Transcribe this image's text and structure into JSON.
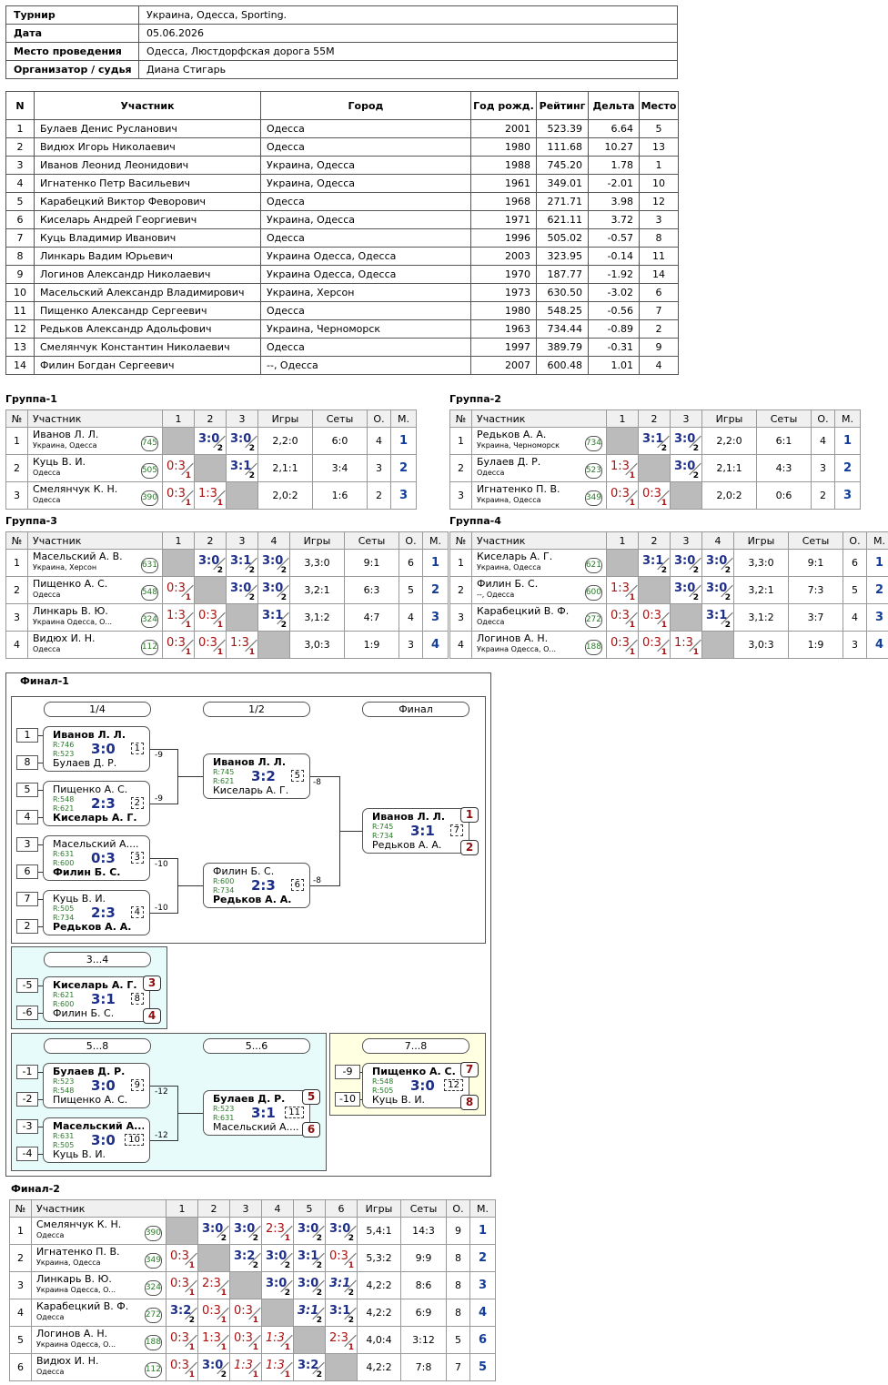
{
  "info": {
    "rows": [
      {
        "k": "Турнир",
        "v": "Украина, Одесса, Sporting."
      },
      {
        "k": "Дата",
        "v": "05.06.2026"
      },
      {
        "k": "Место проведения",
        "v": "Одесса, Люстдорфская дорога 55М"
      },
      {
        "k": "Организатор / судья",
        "v": "Диана Стигарь"
      }
    ]
  },
  "players_table": {
    "headers": [
      "N",
      "Участник",
      "Город",
      "Год рожд.",
      "Рейтинг",
      "Дельта",
      "Место"
    ],
    "rows": [
      [
        "1",
        "Булаев Денис Русланович",
        "Одесса",
        "2001",
        "523.39",
        "6.64",
        "5"
      ],
      [
        "2",
        "Видюх Игорь Николаевич",
        "Одесса",
        "1980",
        "111.68",
        "10.27",
        "13"
      ],
      [
        "3",
        "Иванов Леонид Леонидович",
        "Украина, Одесса",
        "1988",
        "745.20",
        "1.78",
        "1"
      ],
      [
        "4",
        "Игнатенко Петр Васильевич",
        "Украина, Одесса",
        "1961",
        "349.01",
        "-2.01",
        "10"
      ],
      [
        "5",
        "Карабецкий Виктор Феворович",
        "Одесса",
        "1968",
        "271.71",
        "3.98",
        "12"
      ],
      [
        "6",
        "Киселарь Андрей Георгиевич",
        "Украина, Одесса",
        "1971",
        "621.11",
        "3.72",
        "3"
      ],
      [
        "7",
        "Куць Владимир Иванович",
        "Одесса",
        "1996",
        "505.02",
        "-0.57",
        "8"
      ],
      [
        "8",
        "Линкарь Вадим Юрьевич",
        "Украина Одесса, Одесса",
        "2003",
        "323.95",
        "-0.14",
        "11"
      ],
      [
        "9",
        "Логинов Александр Николаевич",
        "Украина Одесса, Одесса",
        "1970",
        "187.77",
        "-1.92",
        "14"
      ],
      [
        "10",
        "Масельский Александр Владимирович",
        "Украина, Херсон",
        "1973",
        "630.50",
        "-3.02",
        "6"
      ],
      [
        "11",
        "Пищенко Александр Сергеевич",
        "Одесса",
        "1980",
        "548.25",
        "-0.56",
        "7"
      ],
      [
        "12",
        "Редьков Александр Адольфович",
        "Украина, Черноморск",
        "1963",
        "734.44",
        "-0.89",
        "2"
      ],
      [
        "13",
        "Смелянчук Константин Николаевич",
        "Одесса",
        "1997",
        "389.79",
        "-0.31",
        "9"
      ],
      [
        "14",
        "Филин Богдан Сергеевич",
        "--, Одесса",
        "2007",
        "600.48",
        "1.01",
        "4"
      ]
    ]
  },
  "group_headers": {
    "no": "№",
    "name": "Участник",
    "games": "Игры",
    "sets": "Сеты",
    "points": "О.",
    "place": "М."
  },
  "groups": [
    {
      "title": "Группа-1",
      "cols": [
        "1",
        "2",
        "3"
      ],
      "rows": [
        {
          "n": "1",
          "name": "Иванов Л. Л.",
          "city": "Украина, Одесса",
          "rating": "745",
          "cells": [
            null,
            [
              "3:0",
              "2",
              "w"
            ],
            [
              "3:0",
              "2",
              "w"
            ]
          ],
          "games": "2,2:0",
          "sets": "6:0",
          "pts": "4",
          "place": "1"
        },
        {
          "n": "2",
          "name": "Куць В. И.",
          "city": "Одесса",
          "rating": "505",
          "cells": [
            [
              "0:3",
              "1",
              "l"
            ],
            null,
            [
              "3:1",
              "2",
              "w"
            ]
          ],
          "games": "2,1:1",
          "sets": "3:4",
          "pts": "3",
          "place": "2"
        },
        {
          "n": "3",
          "name": "Смелянчук К. Н.",
          "city": "Одесса",
          "rating": "390",
          "cells": [
            [
              "0:3",
              "1",
              "l"
            ],
            [
              "1:3",
              "1",
              "l"
            ],
            null
          ],
          "games": "2,0:2",
          "sets": "1:6",
          "pts": "2",
          "place": "3"
        }
      ]
    },
    {
      "title": "Группа-2",
      "cols": [
        "1",
        "2",
        "3"
      ],
      "rows": [
        {
          "n": "1",
          "name": "Редьков А. А.",
          "city": "Украина, Черноморск",
          "rating": "734",
          "cells": [
            null,
            [
              "3:1",
              "2",
              "w"
            ],
            [
              "3:0",
              "2",
              "w"
            ]
          ],
          "games": "2,2:0",
          "sets": "6:1",
          "pts": "4",
          "place": "1"
        },
        {
          "n": "2",
          "name": "Булаев Д. Р.",
          "city": "Одесса",
          "rating": "523",
          "cells": [
            [
              "1:3",
              "1",
              "l"
            ],
            null,
            [
              "3:0",
              "2",
              "w"
            ]
          ],
          "games": "2,1:1",
          "sets": "4:3",
          "pts": "3",
          "place": "2"
        },
        {
          "n": "3",
          "name": "Игнатенко П. В.",
          "city": "Украина, Одесса",
          "rating": "349",
          "cells": [
            [
              "0:3",
              "1",
              "l"
            ],
            [
              "0:3",
              "1",
              "l"
            ],
            null
          ],
          "games": "2,0:2",
          "sets": "0:6",
          "pts": "2",
          "place": "3"
        }
      ]
    },
    {
      "title": "Группа-3",
      "cols": [
        "1",
        "2",
        "3",
        "4"
      ],
      "rows": [
        {
          "n": "1",
          "name": "Масельский А. В.",
          "city": "Украина, Херсон",
          "rating": "631",
          "cells": [
            null,
            [
              "3:0",
              "2",
              "w"
            ],
            [
              "3:1",
              "2",
              "w"
            ],
            [
              "3:0",
              "2",
              "w"
            ]
          ],
          "games": "3,3:0",
          "sets": "9:1",
          "pts": "6",
          "place": "1"
        },
        {
          "n": "2",
          "name": "Пищенко А. С.",
          "city": "Одесса",
          "rating": "548",
          "cells": [
            [
              "0:3",
              "1",
              "l"
            ],
            null,
            [
              "3:0",
              "2",
              "w"
            ],
            [
              "3:0",
              "2",
              "w"
            ]
          ],
          "games": "3,2:1",
          "sets": "6:3",
          "pts": "5",
          "place": "2"
        },
        {
          "n": "3",
          "name": "Линкарь В. Ю.",
          "city": "Украина Одесса, О...",
          "rating": "324",
          "cells": [
            [
              "1:3",
              "1",
              "l"
            ],
            [
              "0:3",
              "1",
              "l"
            ],
            null,
            [
              "3:1",
              "2",
              "w"
            ]
          ],
          "games": "3,1:2",
          "sets": "4:7",
          "pts": "4",
          "place": "3"
        },
        {
          "n": "4",
          "name": "Видюх И. Н.",
          "city": "Одесса",
          "rating": "112",
          "cells": [
            [
              "0:3",
              "1",
              "l"
            ],
            [
              "0:3",
              "1",
              "l"
            ],
            [
              "1:3",
              "1",
              "l"
            ],
            null
          ],
          "games": "3,0:3",
          "sets": "1:9",
          "pts": "3",
          "place": "4"
        }
      ]
    },
    {
      "title": "Группа-4",
      "cols": [
        "1",
        "2",
        "3",
        "4"
      ],
      "rows": [
        {
          "n": "1",
          "name": "Киселарь А. Г.",
          "city": "Украина, Одесса",
          "rating": "621",
          "cells": [
            null,
            [
              "3:1",
              "2",
              "w"
            ],
            [
              "3:0",
              "2",
              "w"
            ],
            [
              "3:0",
              "2",
              "w"
            ]
          ],
          "games": "3,3:0",
          "sets": "9:1",
          "pts": "6",
          "place": "1"
        },
        {
          "n": "2",
          "name": "Филин Б. С.",
          "city": "--, Одесса",
          "rating": "600",
          "cells": [
            [
              "1:3",
              "1",
              "l"
            ],
            null,
            [
              "3:0",
              "2",
              "w"
            ],
            [
              "3:0",
              "2",
              "w"
            ]
          ],
          "games": "3,2:1",
          "sets": "7:3",
          "pts": "5",
          "place": "2"
        },
        {
          "n": "3",
          "name": "Карабецкий В. Ф.",
          "city": "Одесса",
          "rating": "272",
          "cells": [
            [
              "0:3",
              "1",
              "l"
            ],
            [
              "0:3",
              "1",
              "l"
            ],
            null,
            [
              "3:1",
              "2",
              "w"
            ]
          ],
          "games": "3,1:2",
          "sets": "3:7",
          "pts": "4",
          "place": "3"
        },
        {
          "n": "4",
          "name": "Логинов А. Н.",
          "city": "Украина Одесса, О...",
          "rating": "188",
          "cells": [
            [
              "0:3",
              "1",
              "l"
            ],
            [
              "0:3",
              "1",
              "l"
            ],
            [
              "1:3",
              "1",
              "l"
            ],
            null
          ],
          "games": "3,0:3",
          "sets": "1:9",
          "pts": "3",
          "place": "4"
        }
      ]
    }
  ],
  "final1": {
    "title": "Финал-1",
    "rounds": {
      "r1": "1/4",
      "r2": "1/2",
      "r3": "Финал",
      "p34": "3...4",
      "p58": "5...8",
      "p56": "5...6",
      "p78": "7...8"
    },
    "seeds": [
      "1",
      "8",
      "5",
      "4",
      "3",
      "6",
      "7",
      "2",
      "-5",
      "-6",
      "-1",
      "-2",
      "-3",
      "-4",
      "-9",
      "-10"
    ],
    "losers": [
      "-9",
      "-9",
      "-10",
      "-10",
      "-8",
      "-8",
      "-12",
      "-12"
    ],
    "places": [
      "1",
      "2",
      "3",
      "4",
      "5",
      "6",
      "7",
      "8"
    ],
    "matches": [
      {
        "p1": "Иванов Л. Л.",
        "p2": "Булаев Д. Р.",
        "r1": "R:746",
        "r2": "R:523",
        "s": "3:0",
        "n": "1",
        "w": 1
      },
      {
        "p1": "Пищенко А. С.",
        "p2": "Киселарь А. Г.",
        "r1": "R:548",
        "r2": "R:621",
        "s": "2:3",
        "n": "2",
        "w": 2
      },
      {
        "p1": "Масельский А....",
        "p2": "Филин Б. С.",
        "r1": "R:631",
        "r2": "R:600",
        "s": "0:3",
        "n": "3",
        "w": 2
      },
      {
        "p1": "Куць В. И.",
        "p2": "Редьков А. А.",
        "r1": "R:505",
        "r2": "R:734",
        "s": "2:3",
        "n": "4",
        "w": 2
      },
      {
        "p1": "Иванов Л. Л.",
        "p2": "Киселарь А. Г.",
        "r1": "R:745",
        "r2": "R:621",
        "s": "3:2",
        "n": "5",
        "w": 1
      },
      {
        "p1": "Филин Б. С.",
        "p2": "Редьков А. А.",
        "r1": "R:600",
        "r2": "R:734",
        "s": "2:3",
        "n": "6",
        "w": 2
      },
      {
        "p1": "Иванов Л. Л.",
        "p2": "Редьков А. А.",
        "r1": "R:745",
        "r2": "R:734",
        "s": "3:1",
        "n": "7",
        "w": 1
      },
      {
        "p1": "Киселарь А. Г.",
        "p2": "Филин Б. С.",
        "r1": "R:621",
        "r2": "R:600",
        "s": "3:1",
        "n": "8",
        "w": 1
      },
      {
        "p1": "Булаев Д. Р.",
        "p2": "Пищенко А. С.",
        "r1": "R:523",
        "r2": "R:548",
        "s": "3:0",
        "n": "9",
        "w": 1
      },
      {
        "p1": "Масельский А....",
        "p2": "Куць В. И.",
        "r1": "R:631",
        "r2": "R:505",
        "s": "3:0",
        "n": "10",
        "w": 1
      },
      {
        "p1": "Булаев Д. Р.",
        "p2": "Масельский А....",
        "r1": "R:523",
        "r2": "R:631",
        "s": "3:1",
        "n": "11",
        "w": 1
      },
      {
        "p1": "Пищенко А. С.",
        "p2": "Куць В. И.",
        "r1": "R:548",
        "r2": "R:505",
        "s": "3:0",
        "n": "12",
        "w": 1
      }
    ]
  },
  "final2": {
    "title": "Финал-2",
    "cols": [
      "1",
      "2",
      "3",
      "4",
      "5",
      "6"
    ],
    "rows": [
      {
        "n": "1",
        "name": "Смелянчук К. Н.",
        "city": "Одесса",
        "rating": "390",
        "cells": [
          null,
          [
            "3:0",
            "2",
            "w"
          ],
          [
            "3:0",
            "2",
            "w"
          ],
          [
            "2:3",
            "1",
            "l"
          ],
          [
            "3:0",
            "2",
            "w"
          ],
          [
            "3:0",
            "2",
            "w"
          ]
        ],
        "games": "5,4:1",
        "sets": "14:3",
        "pts": "9",
        "place": "1"
      },
      {
        "n": "2",
        "name": "Игнатенко П. В.",
        "city": "Украина, Одесса",
        "rating": "349",
        "cells": [
          [
            "0:3",
            "1",
            "l"
          ],
          null,
          [
            "3:2",
            "2",
            "w"
          ],
          [
            "3:0",
            "2",
            "w"
          ],
          [
            "3:1",
            "2",
            "w"
          ],
          [
            "0:3",
            "1",
            "l"
          ]
        ],
        "games": "5,3:2",
        "sets": "9:9",
        "pts": "8",
        "place": "2"
      },
      {
        "n": "3",
        "name": "Линкарь В. Ю.",
        "city": "Украина Одесса, О...",
        "rating": "324",
        "cells": [
          [
            "0:3",
            "1",
            "l"
          ],
          [
            "2:3",
            "1",
            "l"
          ],
          null,
          [
            "3:0",
            "2",
            "w"
          ],
          [
            "3:0",
            "2",
            "w"
          ],
          [
            "3:1",
            "2",
            "wi"
          ]
        ],
        "games": "4,2:2",
        "sets": "8:6",
        "pts": "8",
        "place": "3"
      },
      {
        "n": "4",
        "name": "Карабецкий В. Ф.",
        "city": "Одесса",
        "rating": "272",
        "cells": [
          [
            "3:2",
            "2",
            "w"
          ],
          [
            "0:3",
            "1",
            "l"
          ],
          [
            "0:3",
            "1",
            "l"
          ],
          null,
          [
            "3:1",
            "2",
            "wi"
          ],
          [
            "3:1",
            "2",
            "w"
          ]
        ],
        "games": "4,2:2",
        "sets": "6:9",
        "pts": "8",
        "place": "4"
      },
      {
        "n": "5",
        "name": "Логинов А. Н.",
        "city": "Украина Одесса, О...",
        "rating": "188",
        "cells": [
          [
            "0:3",
            "1",
            "l"
          ],
          [
            "1:3",
            "1",
            "l"
          ],
          [
            "0:3",
            "1",
            "l"
          ],
          [
            "1:3",
            "1",
            "li"
          ],
          null,
          [
            "2:3",
            "1",
            "l"
          ]
        ],
        "games": "4,0:4",
        "sets": "3:12",
        "pts": "5",
        "place": "6"
      },
      {
        "n": "6",
        "name": "Видюх И. Н.",
        "city": "Одесса",
        "rating": "112",
        "cells": [
          [
            "0:3",
            "1",
            "l"
          ],
          [
            "3:0",
            "2",
            "w"
          ],
          [
            "1:3",
            "1",
            "li"
          ],
          [
            "1:3",
            "1",
            "li"
          ],
          [
            "3:2",
            "2",
            "w"
          ],
          null
        ],
        "games": "4,2:2",
        "sets": "7:8",
        "pts": "7",
        "place": "5"
      }
    ]
  }
}
